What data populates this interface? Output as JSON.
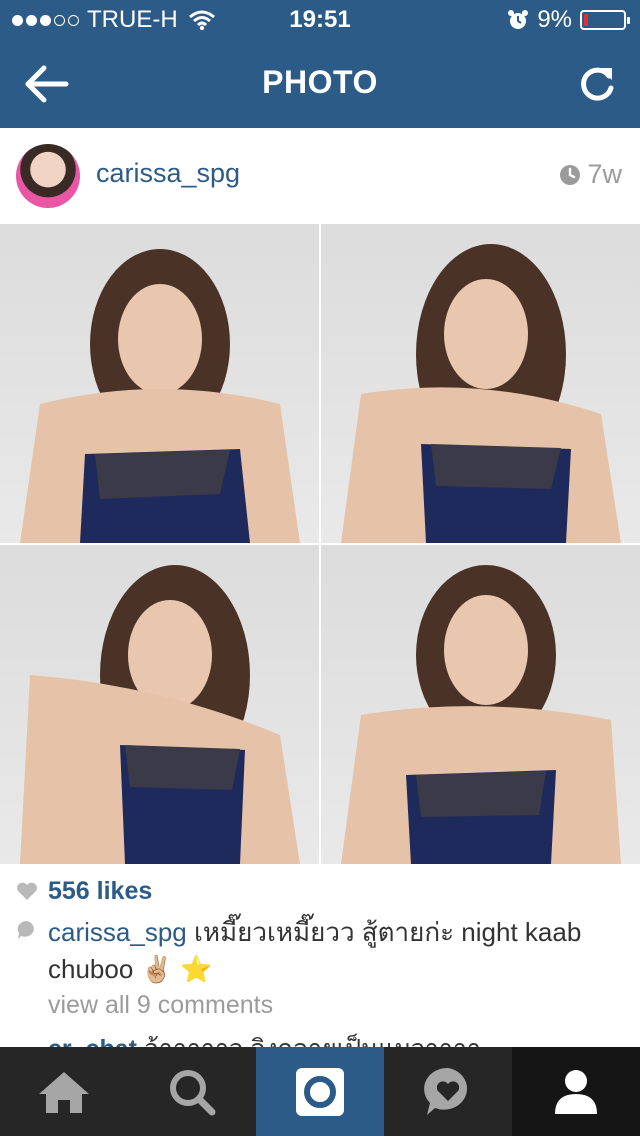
{
  "status_bar": {
    "carrier": "TRUE-H",
    "time": "19:51",
    "battery_percent": "9%",
    "signal_bars_filled": 3,
    "signal_bars_total": 5
  },
  "nav": {
    "title": "PHOTO",
    "back_icon": "back-arrow-icon",
    "refresh_icon": "refresh-icon"
  },
  "post": {
    "username": "carissa_spg",
    "time_ago": "7w",
    "likes": "556 likes",
    "caption_user": "carissa_spg",
    "caption_text": "เหมี๊ยวเหมี๊ยวว สู้ตายก่ะ night kaab chuboo ✌🏼 ⭐",
    "view_all": "view all 9 comments",
    "comment_user": "cr_chat",
    "comment_text": "อ้าาาาาว ลิงกลายเป็นแมวาาาา"
  },
  "tabs": [
    {
      "name": "home",
      "icon": "home-icon"
    },
    {
      "name": "explore",
      "icon": "search-icon"
    },
    {
      "name": "camera",
      "icon": "camera-icon",
      "active": true
    },
    {
      "name": "activity",
      "icon": "heart-bubble-icon"
    },
    {
      "name": "profile",
      "icon": "profile-icon"
    }
  ],
  "colors": {
    "brand_blue": "#2d5b87",
    "link_blue": "#2d5b87",
    "tabbar_bg": "#262626",
    "battery_low": "#e03030"
  }
}
